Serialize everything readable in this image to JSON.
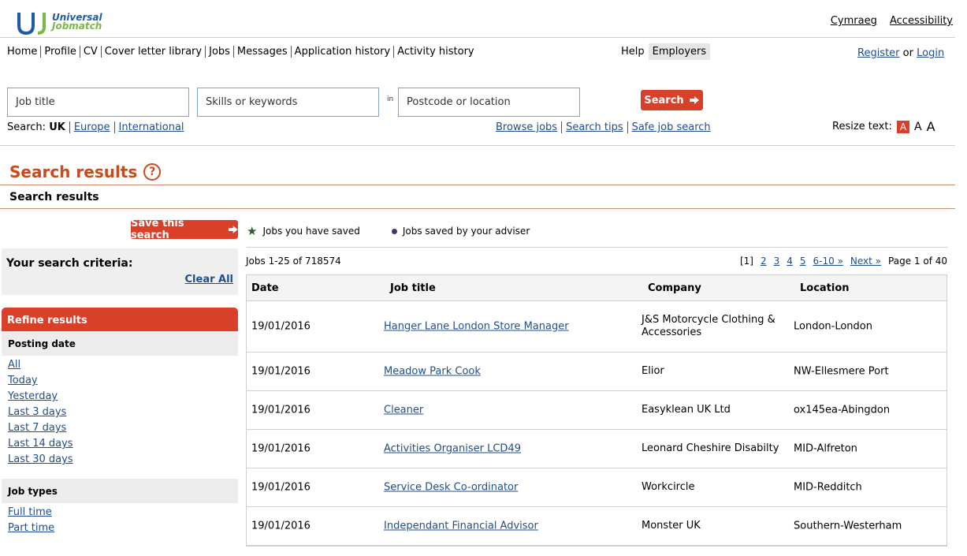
{
  "brand": {
    "line1": "Universal",
    "line2": "Jobmatch"
  },
  "top_links": [
    "Cymraeg",
    "Accessibility"
  ],
  "nav": [
    "Home",
    "Profile",
    "CV",
    "Cover letter library",
    "Jobs",
    "Messages",
    "Application history",
    "Activity history"
  ],
  "help_nav": {
    "help": "Help",
    "employers": "Employers"
  },
  "auth": {
    "register": "Register",
    "or": "or",
    "login": "Login"
  },
  "search": {
    "job_title_placeholder": "Job title",
    "skills_placeholder": "Skills or keywords",
    "in_label": "in",
    "location_placeholder": "Postcode or location",
    "button": "Search"
  },
  "scope": {
    "label": "Search:",
    "uk": "UK",
    "europe": "Europe",
    "international": "International"
  },
  "browse_links": [
    "Browse jobs",
    "Search tips",
    "Safe job search"
  ],
  "resize": {
    "label": "Resize text:",
    "a": "A"
  },
  "page_title": "Search results",
  "help_icon": "?",
  "sub_title": "Search results",
  "save_search": "Save this search",
  "legend": {
    "saved": "Jobs you have saved",
    "adviser": "Jobs saved by your adviser"
  },
  "criteria": {
    "label": "Your search criteria:",
    "clear": "Clear All"
  },
  "refine": {
    "heading": "Refine results",
    "posting_date": {
      "heading": "Posting date",
      "items": [
        "All",
        "Today",
        "Yesterday",
        "Last 3 days",
        "Last 7 days",
        "Last 14 days",
        "Last 30 days"
      ]
    },
    "job_types": {
      "heading": "Job types",
      "items": [
        "Full time",
        "Part time"
      ]
    }
  },
  "results": {
    "count": "Jobs 1-25 of 718574",
    "pager": {
      "current": "[1]",
      "pages": [
        "2",
        "3",
        "4",
        "5",
        "6-10 »",
        "Next »"
      ],
      "page_of": "Page 1 of 40"
    },
    "columns": {
      "date": "Date",
      "title": "Job title",
      "company": "Company",
      "location": "Location"
    },
    "rows": [
      {
        "date": "19/01/2016",
        "title": "Hanger Lane London Store Manager",
        "company": "J&S Motorcycle Clothing & Accessories",
        "location": "London-London"
      },
      {
        "date": "19/01/2016",
        "title": "Meadow Park Cook",
        "company": "Elior",
        "location": "NW-Ellesmere Port"
      },
      {
        "date": "19/01/2016",
        "title": "Cleaner",
        "company": "Easyklean UK Ltd",
        "location": "ox145ea-Abingdon"
      },
      {
        "date": "19/01/2016",
        "title": "Activities Organiser LCD49",
        "company": "Leonard Cheshire Disabilty",
        "location": "MID-Alfreton"
      },
      {
        "date": "19/01/2016",
        "title": "Service Desk Co-ordinator",
        "company": "Workcircle",
        "location": "MID-Redditch"
      },
      {
        "date": "19/01/2016",
        "title": "Independant Financial Advisor",
        "company": "Monster UK",
        "location": "Southern-Westerham"
      }
    ]
  },
  "colors": {
    "accent": "#d9402a",
    "title": "#c94a1c",
    "link": "#1f4e8c"
  }
}
